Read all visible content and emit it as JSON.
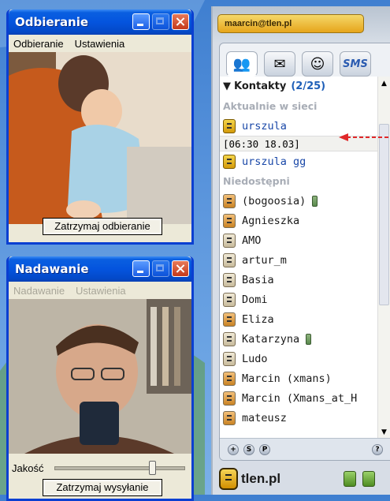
{
  "receive_window": {
    "title": "Odbieranie",
    "menu": [
      "Odbieranie",
      "Ustawienia"
    ],
    "stop_button": "Zatrzymaj odbieranie"
  },
  "send_window": {
    "title": "Nadawanie",
    "menu": [
      "Nadawanie",
      "Ustawienia"
    ],
    "quality_label": "Jakość",
    "quality_level": 0.75,
    "stop_button": "Zatrzymaj wysyłanie"
  },
  "tlen": {
    "nick_field": "maarcin@tlen.pl",
    "tabs": [
      "contacts-icon",
      "mail-icon",
      "tlen-icon",
      "SMS"
    ],
    "group": {
      "name": "Kontakty",
      "count": "(2/25)"
    },
    "online_section": "Aktualnie w sieci",
    "online": [
      {
        "name": "urszula",
        "status": "[06:30 18.03]"
      },
      {
        "name": "urszula gg"
      }
    ],
    "offline_section": "Niedostępni",
    "offline": [
      {
        "name": "(bogoosia)",
        "phone": true,
        "warm": true
      },
      {
        "name": "Agnieszka",
        "warm": true
      },
      {
        "name": "AMO"
      },
      {
        "name": "artur_m"
      },
      {
        "name": "Basia"
      },
      {
        "name": "Domi"
      },
      {
        "name": "Eliza",
        "warm": true
      },
      {
        "name": "Katarzyna",
        "phone": true
      },
      {
        "name": "Ludo"
      },
      {
        "name": "Marcin (xmans)",
        "warm": true
      },
      {
        "name": "Marcin (Xmans_at_H",
        "warm": true
      },
      {
        "name": "mateusz",
        "warm": true
      }
    ],
    "action_buttons": [
      "+",
      "S",
      "P"
    ],
    "help_button": "?",
    "brand": "tlen.pl"
  },
  "colors": {
    "xp_blue": "#0454de",
    "online_name": "#1a48a8",
    "annotation": "#e0282a"
  }
}
